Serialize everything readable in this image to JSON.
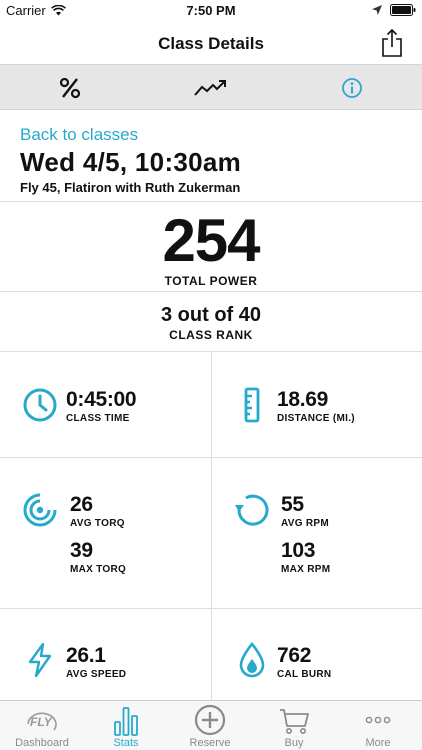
{
  "status": {
    "carrier": "Carrier",
    "time": "7:50 PM"
  },
  "nav": {
    "title": "Class Details"
  },
  "segments": [
    {
      "icon": "percent-icon"
    },
    {
      "icon": "trend-icon"
    },
    {
      "icon": "info-icon",
      "active": true
    }
  ],
  "header": {
    "back": "Back to classes",
    "date": "Wed 4/5, 10:30am",
    "desc": "Fly 45, Flatiron with Ruth Zukerman"
  },
  "power": {
    "value": "254",
    "label": "TOTAL POWER"
  },
  "rank": {
    "value": "3 out of 40",
    "label": "CLASS RANK"
  },
  "stats": {
    "class_time": {
      "value": "0:45:00",
      "label": "CLASS TIME"
    },
    "distance": {
      "value": "18.69",
      "label": "DISTANCE (MI.)"
    },
    "avg_torq": {
      "value": "26",
      "label": "AVG TORQ"
    },
    "max_torq": {
      "value": "39",
      "label": "MAX TORQ"
    },
    "avg_rpm": {
      "value": "55",
      "label": "AVG RPM"
    },
    "max_rpm": {
      "value": "103",
      "label": "MAX RPM"
    },
    "avg_speed": {
      "value": "26.1",
      "label": "AVG SPEED"
    },
    "cal_burn": {
      "value": "762",
      "label": "CAL BURN"
    }
  },
  "tabs": [
    {
      "label": "Dashboard"
    },
    {
      "label": "Stats",
      "active": true
    },
    {
      "label": "Reserve"
    },
    {
      "label": "Buy"
    },
    {
      "label": "More"
    }
  ],
  "colors": {
    "accent": "#27a9cc",
    "inactive": "#8a8a8a",
    "segment_bg": "#e6e6e6"
  }
}
